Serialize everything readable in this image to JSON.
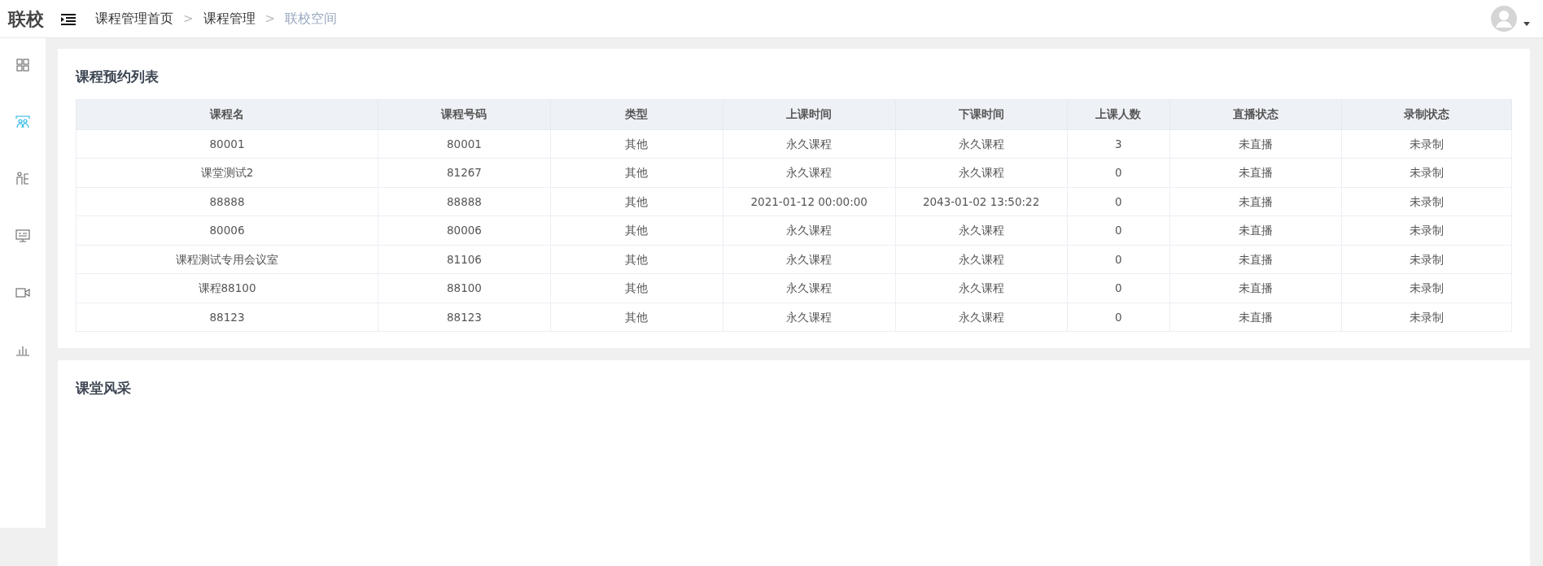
{
  "header": {
    "logo": "联校",
    "breadcrumb": [
      {
        "label": "课程管理首页",
        "current": false
      },
      {
        "label": "课程管理",
        "current": false
      },
      {
        "label": "联校空间",
        "current": true
      }
    ],
    "separator": ">"
  },
  "sidebar": {
    "items": [
      {
        "kind": "grid",
        "selected": false
      },
      {
        "kind": "group",
        "selected": true
      },
      {
        "kind": "person",
        "selected": false
      },
      {
        "kind": "monitor",
        "selected": false
      },
      {
        "kind": "video",
        "selected": false
      },
      {
        "kind": "chart",
        "selected": false
      }
    ]
  },
  "booking_list": {
    "title": "课程预约列表",
    "table": {
      "columns": [
        "课程名",
        "课程号码",
        "类型",
        "上课时间",
        "下课时间",
        "上课人数",
        "直播状态",
        "录制状态"
      ],
      "rows": [
        [
          "80001",
          "80001",
          "其他",
          "永久课程",
          "永久课程",
          "3",
          "未直播",
          "未录制"
        ],
        [
          "课堂测试2",
          "81267",
          "其他",
          "永久课程",
          "永久课程",
          "0",
          "未直播",
          "未录制"
        ],
        [
          "88888",
          "88888",
          "其他",
          "2021-01-12 00:00:00",
          "2043-01-02 13:50:22",
          "0",
          "未直播",
          "未录制"
        ],
        [
          "80006",
          "80006",
          "其他",
          "永久课程",
          "永久课程",
          "0",
          "未直播",
          "未录制"
        ],
        [
          "课程测试专用会议室",
          "81106",
          "其他",
          "永久课程",
          "永久课程",
          "0",
          "未直播",
          "未录制"
        ],
        [
          "课程88100",
          "88100",
          "其他",
          "永久课程",
          "永久课程",
          "0",
          "未直播",
          "未录制"
        ],
        [
          "88123",
          "88123",
          "其他",
          "永久课程",
          "永久课程",
          "0",
          "未直播",
          "未录制"
        ]
      ]
    }
  },
  "gallery": {
    "title": "课堂风采"
  }
}
